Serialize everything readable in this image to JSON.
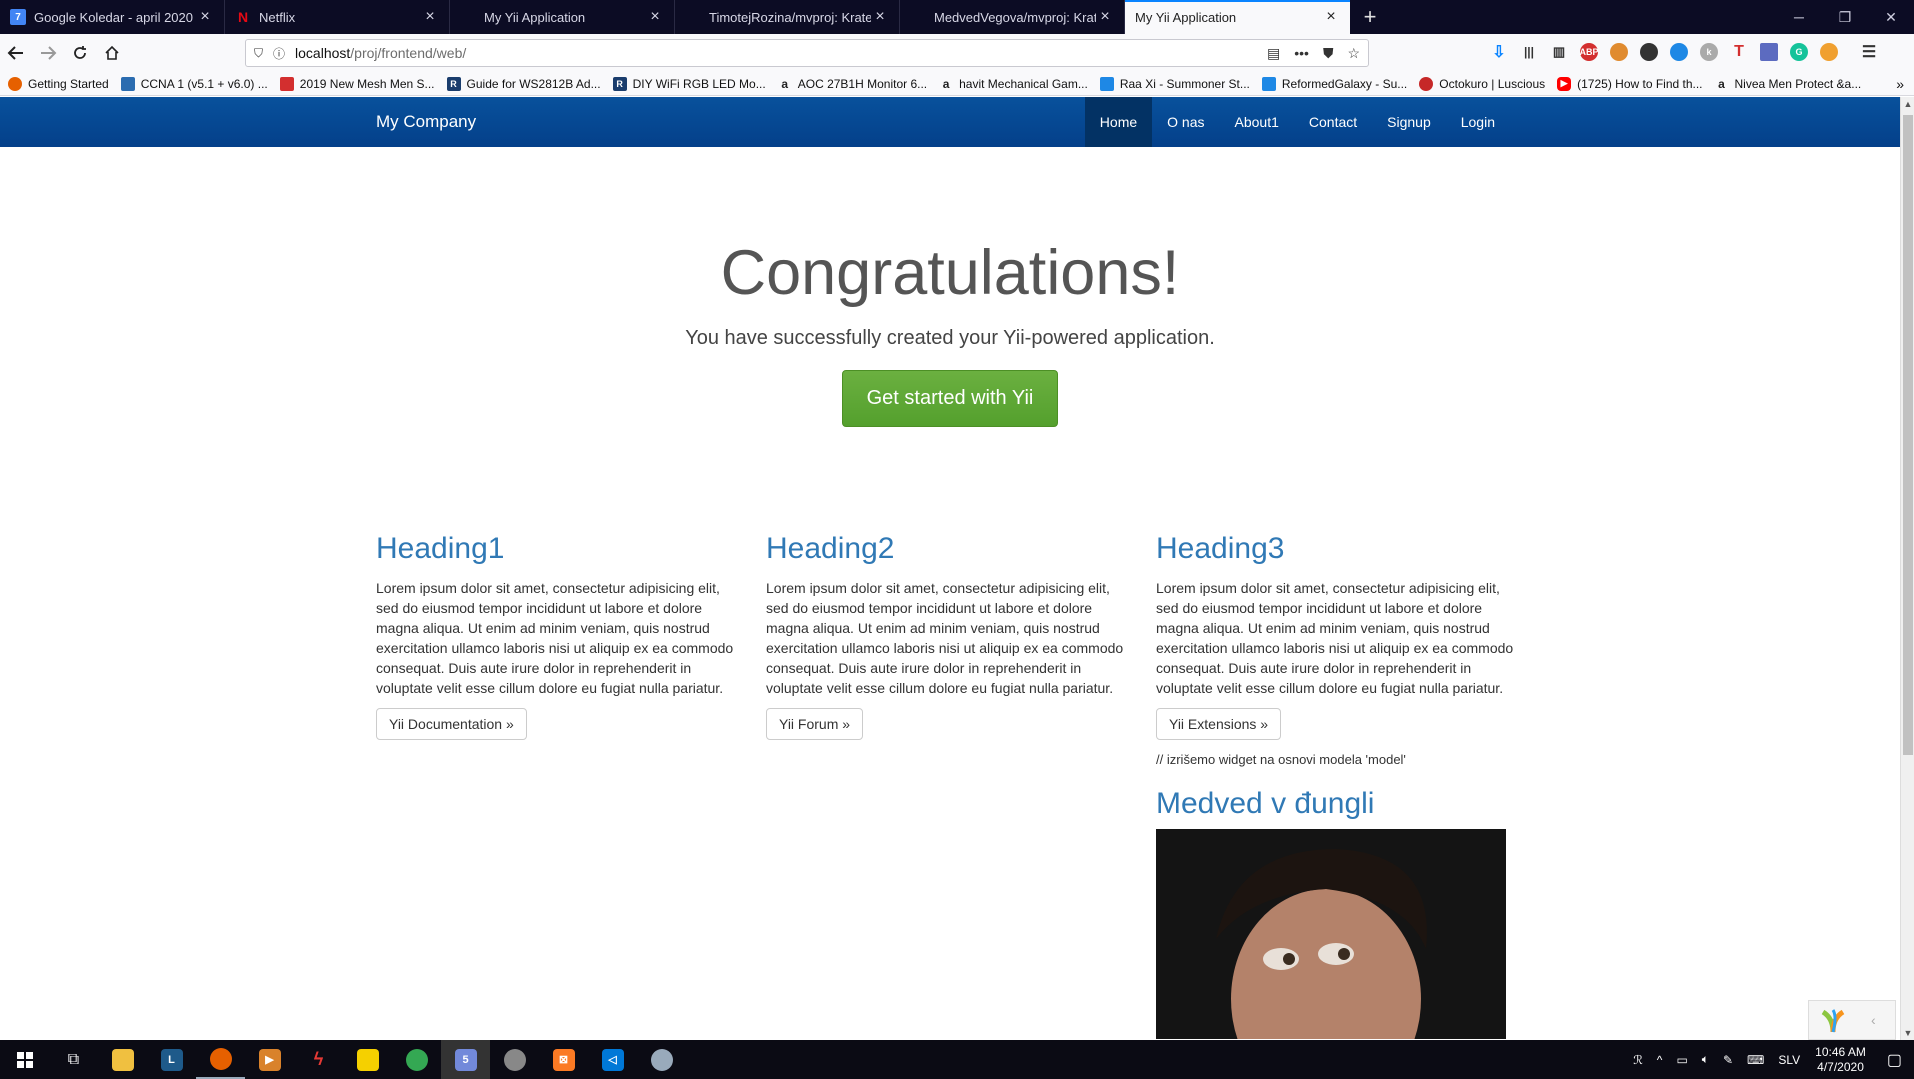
{
  "browser": {
    "tabs": [
      {
        "title": "Google Koledar - april 2020",
        "icon": "calendar-icon",
        "color": "#4285f4",
        "glyph": "7"
      },
      {
        "title": "Netflix",
        "icon": "netflix-icon",
        "color": "#e50914",
        "glyph": "N"
      },
      {
        "title": "My Yii Application",
        "icon": "page-icon",
        "color": "#0c0c24",
        "glyph": ""
      },
      {
        "title": "TimotejRozina/mvproj: Kratek",
        "icon": "github-icon",
        "color": "#0c0c24",
        "glyph": ""
      },
      {
        "title": "MedvedVegova/mvproj: Kratek",
        "icon": "github-icon",
        "color": "#0c0c24",
        "glyph": ""
      },
      {
        "title": "My Yii Application",
        "icon": "page-icon",
        "color": "#f9f9fb",
        "glyph": ""
      }
    ],
    "url_host": "localhost",
    "url_path": "/proj/frontend/web/",
    "bookmarks": [
      {
        "label": "Getting Started",
        "icon": "firefox-icon",
        "color": "#e66000"
      },
      {
        "label": "CCNA 1 (v5.1 + v6.0) ...",
        "icon": "ccna-icon",
        "color": "#2b6cb0"
      },
      {
        "label": "2019 New Mesh Men S...",
        "icon": "shop-icon",
        "color": "#d32f2f"
      },
      {
        "label": "Guide for WS2812B Ad...",
        "icon": "r-icon",
        "color": "#1a3d6d"
      },
      {
        "label": "DIY WiFi RGB LED Mo...",
        "icon": "r-icon",
        "color": "#1a3d6d"
      },
      {
        "label": "AOC 27B1H Monitor 6...",
        "icon": "amazon-icon",
        "color": "#222222"
      },
      {
        "label": "havit Mechanical Gam...",
        "icon": "amazon-icon",
        "color": "#222222"
      },
      {
        "label": "Raa Xi - Summoner St...",
        "icon": "opgg-icon",
        "color": "#1e88e5"
      },
      {
        "label": "ReformedGalaxy - Su...",
        "icon": "opgg-icon",
        "color": "#1e88e5"
      },
      {
        "label": "Octokuro | Luscious",
        "icon": "luscious-icon",
        "color": "#c62828"
      },
      {
        "label": "(1725) How to Find th...",
        "icon": "youtube-icon",
        "color": "#ff0000"
      },
      {
        "label": "Nivea Men Protect &a...",
        "icon": "amazon-icon",
        "color": "#222222"
      }
    ]
  },
  "site": {
    "brand": "My Company",
    "nav": [
      {
        "label": "Home",
        "active": true
      },
      {
        "label": "O nas",
        "active": false
      },
      {
        "label": "About1",
        "active": false
      },
      {
        "label": "Contact",
        "active": false
      },
      {
        "label": "Signup",
        "active": false
      },
      {
        "label": "Login",
        "active": false
      }
    ],
    "jumbotron": {
      "title": "Congratulations!",
      "lead": "You have successfully created your Yii-powered application.",
      "button": "Get started with Yii"
    },
    "columns": [
      {
        "heading": "Heading1",
        "text": "Lorem ipsum dolor sit amet, consectetur adipisicing elit, sed do eiusmod tempor incididunt ut labore et dolore magna aliqua. Ut enim ad minim veniam, quis nostrud exercitation ullamco laboris nisi ut aliquip ex ea commodo consequat. Duis aute irure dolor in reprehenderit in voluptate velit esse cillum dolore eu fugiat nulla pariatur.",
        "button": "Yii Documentation »"
      },
      {
        "heading": "Heading2",
        "text": "Lorem ipsum dolor sit amet, consectetur adipisicing elit, sed do eiusmod tempor incididunt ut labore et dolore magna aliqua. Ut enim ad minim veniam, quis nostrud exercitation ullamco laboris nisi ut aliquip ex ea commodo consequat. Duis aute irure dolor in reprehenderit in voluptate velit esse cillum dolore eu fugiat nulla pariatur.",
        "button": "Yii Forum »"
      },
      {
        "heading": "Heading3",
        "text": "Lorem ipsum dolor sit amet, consectetur adipisicing elit, sed do eiusmod tempor incididunt ut labore et dolore magna aliqua. Ut enim ad minim veniam, quis nostrud exercitation ullamco laboris nisi ut aliquip ex ea commodo consequat. Duis aute irure dolor in reprehenderit in voluptate velit esse cillum dolore eu fugiat nulla pariatur.",
        "button": "Yii Extensions »"
      }
    ],
    "widget_note": "// izrišemo widget na osnovi modela 'model'",
    "widget_heading": "Medved v đungli"
  },
  "taskbar": {
    "language": "SLV",
    "time": "10:46 AM",
    "date": "4/7/2020"
  },
  "colors": {
    "navbar": "#04408a",
    "heading_link": "#3079b5",
    "success": "#5cb85c"
  }
}
